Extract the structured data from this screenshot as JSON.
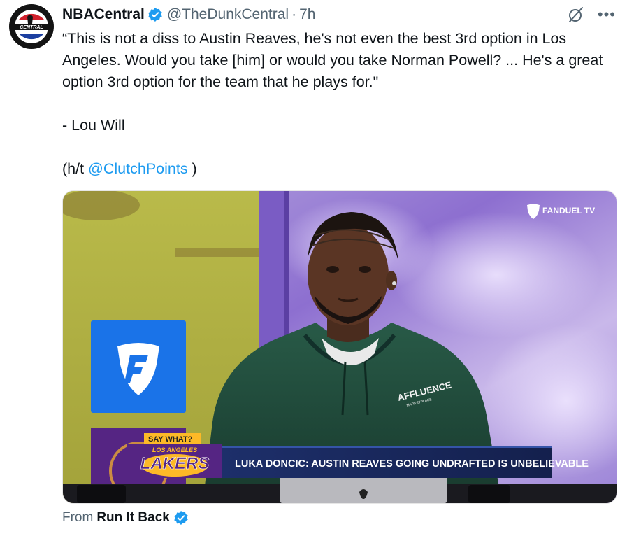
{
  "tweet": {
    "author_name": "NBACentral",
    "handle": "@TheDunkCentral",
    "separator": "·",
    "time": "7h",
    "avatar_text": "CENTRAL",
    "text_line_1": "“This is not a diss to Austin Reaves, he's not even the best 3rd option in Los Angeles. Would you take [him] or would you take Norman Powell? ... He's a great option 3rd option for the team that he plays for.\"",
    "text_line_2": "- Lou Will",
    "hat_tip_prefix": "(h/t ",
    "hat_tip_mention": "@ClutchPoints",
    "hat_tip_suffix": " )",
    "more_icon": "more-horizontal-icon",
    "grok_icon": "grok-icon"
  },
  "media": {
    "watermark": "FANDUEL TV",
    "lower_third_tag": "SAY WHAT?",
    "team_small": "LOS ANGELES",
    "team_big": "LAKERS",
    "headline": "LUKA DONCIC: AUSTIN REAVES GOING UNDRAFTED IS UNBELIEVABLE",
    "hoodie_text": "AFFLUENCE",
    "hoodie_subtext": "MARKETPLACE"
  },
  "source": {
    "from_label": "From",
    "name": "Run It Back"
  },
  "colors": {
    "verified": "#1d9bf0",
    "link": "#1d9bf0",
    "muted": "#536471",
    "hoodie": "#1f4a3a",
    "fanduel_blue": "#1a73e8",
    "lakers_purple": "#552583",
    "lakers_gold": "#fdb927"
  }
}
